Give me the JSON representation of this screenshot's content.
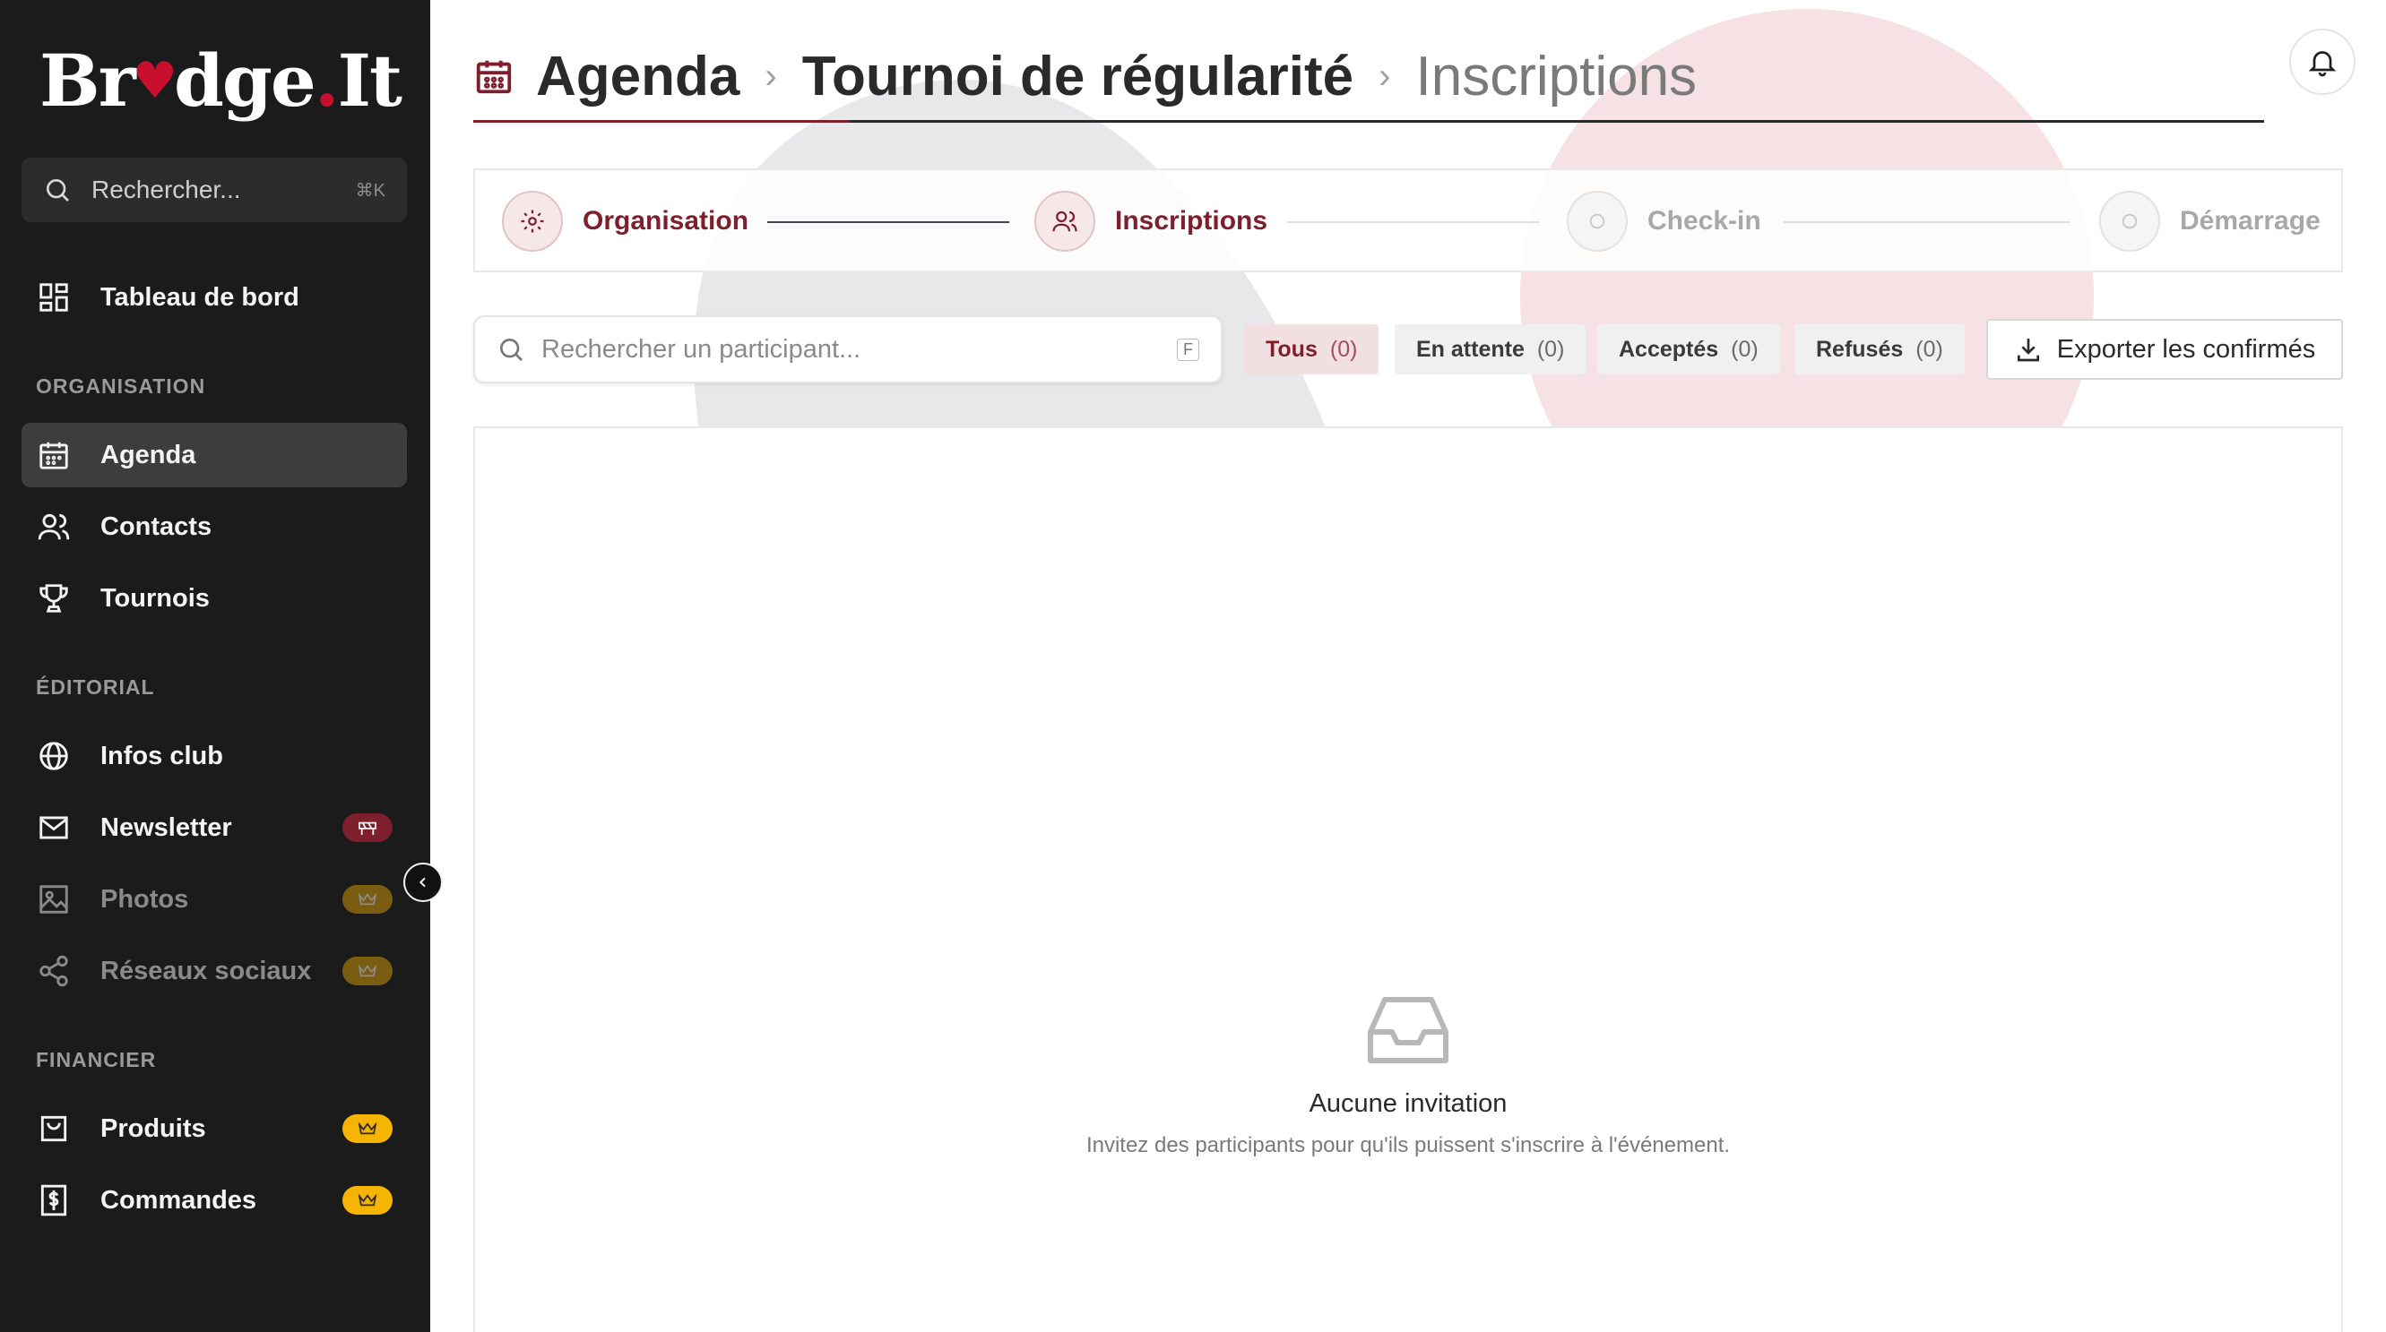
{
  "brand": {
    "logo_part1": "Br",
    "logo_part2": "dge",
    "logo_dot": ".",
    "logo_part3": "It"
  },
  "sidebar": {
    "search_placeholder": "Rechercher...",
    "search_shortcut": "⌘K",
    "dashboard_label": "Tableau de bord",
    "sections": {
      "organisation": "ORGANISATION",
      "editorial": "ÉDITORIAL",
      "financier": "FINANCIER"
    },
    "items": {
      "agenda": "Agenda",
      "contacts": "Contacts",
      "tournois": "Tournois",
      "infos_club": "Infos club",
      "newsletter": "Newsletter",
      "photos": "Photos",
      "reseaux": "Réseaux sociaux",
      "produits": "Produits",
      "commandes": "Commandes"
    }
  },
  "breadcrumb": {
    "root": "Agenda",
    "event": "Tournoi de régularité",
    "current": "Inscriptions"
  },
  "stepper": {
    "steps": [
      "Organisation",
      "Inscriptions",
      "Check-in",
      "Démarrage"
    ],
    "active_index": 1
  },
  "toolbar": {
    "search_placeholder": "Rechercher un participant...",
    "search_shortcut": "F",
    "filters": [
      {
        "label": "Tous",
        "count": "(0)"
      },
      {
        "label": "En attente",
        "count": "(0)"
      },
      {
        "label": "Acceptés",
        "count": "(0)"
      },
      {
        "label": "Refusés",
        "count": "(0)"
      }
    ],
    "export_label": "Exporter les confirmés"
  },
  "empty_state": {
    "title": "Aucune invitation",
    "subtitle": "Invitez des participants pour qu'ils puissent s'inscrire à l'événement."
  },
  "colors": {
    "accent": "#7d1f2c",
    "sidebar_bg": "#1b1b1b",
    "gold": "#f4b400"
  }
}
